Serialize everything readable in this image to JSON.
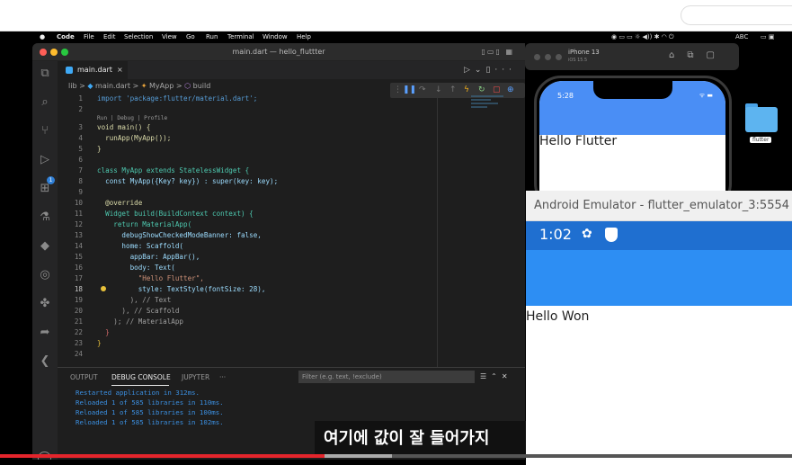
{
  "menubar": {
    "app": "Code",
    "items": [
      "File",
      "Edit",
      "Selection",
      "View",
      "Go",
      "Run",
      "Terminal",
      "Window",
      "Help"
    ],
    "keyboard": "ABC"
  },
  "vscode": {
    "window_title": "main.dart — hello_fluttter",
    "tab": {
      "label": "main.dart",
      "close": "×"
    },
    "breadcrumb": {
      "lib": "lib",
      "file": "main.dart",
      "class": "MyApp",
      "method": "build",
      "sep": ">"
    },
    "codelens": "Run | Debug | Profile",
    "lines": [
      {
        "n": "1",
        "t": "import 'package:flutter/material.dart';"
      },
      {
        "n": "2",
        "t": ""
      },
      {
        "n": "3",
        "t": "void main() {"
      },
      {
        "n": "4",
        "t": "  runApp(MyApp());"
      },
      {
        "n": "5",
        "t": "}"
      },
      {
        "n": "6",
        "t": ""
      },
      {
        "n": "7",
        "t": "class MyApp extends StatelessWidget {"
      },
      {
        "n": "8",
        "t": "  const MyApp({Key? key}) : super(key: key);"
      },
      {
        "n": "9",
        "t": ""
      },
      {
        "n": "10",
        "t": "  @override"
      },
      {
        "n": "11",
        "t": "  Widget build(BuildContext context) {"
      },
      {
        "n": "12",
        "t": "    return MaterialApp("
      },
      {
        "n": "13",
        "t": "      debugShowCheckedModeBanner: false,"
      },
      {
        "n": "14",
        "t": "      home: Scaffold("
      },
      {
        "n": "15",
        "t": "        appBar: AppBar(),"
      },
      {
        "n": "16",
        "t": "        body: Text("
      },
      {
        "n": "17",
        "t": "          \"Hello Flutter\","
      },
      {
        "n": "18",
        "t": "          style: TextStyle(fontSize: 28),"
      },
      {
        "n": "19",
        "t": "        ), // Text"
      },
      {
        "n": "20",
        "t": "      ), // Scaffold"
      },
      {
        "n": "21",
        "t": "    ); // MaterialApp"
      },
      {
        "n": "22",
        "t": "  }"
      },
      {
        "n": "23",
        "t": "}"
      },
      {
        "n": "24",
        "t": ""
      }
    ],
    "panel": {
      "tabs": [
        "OUTPUT",
        "DEBUG CONSOLE",
        "JUPYTER",
        "···"
      ],
      "filter_placeholder": "Filter (e.g. text, !exclude)",
      "console": [
        "Restarted application in 312ms.",
        "Reloaded 1 of 585 libraries in 110ms.",
        "Reloaded 1 of 585 libraries in 100ms.",
        "Reloaded 1 of 585 libraries in 102ms."
      ]
    }
  },
  "ios_simulator": {
    "device": "iPhone 13",
    "os": "iOS 15.5",
    "time": "5:28",
    "hello_text": "Hello Flutter",
    "folder_label": "flutter"
  },
  "android_emulator": {
    "title": "Android Emulator - flutter_emulator_3:5554",
    "time": "1:02",
    "hello_text": "Hello Won"
  },
  "video": {
    "caption": "여기에 값이 잘 들어가지",
    "progress_played": 0.41,
    "buffered_end": 0.495
  },
  "colors": {
    "accent": "#e4252c",
    "ios_appbar": "#4a8ef5",
    "android_status": "#1f6fd0",
    "android_appbar": "#2d8ef3"
  }
}
